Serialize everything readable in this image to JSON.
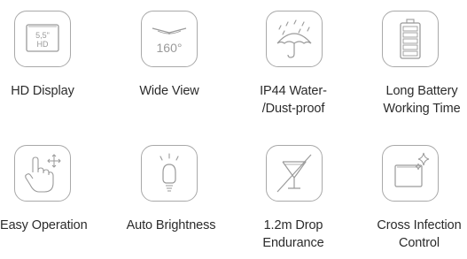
{
  "features": [
    {
      "icon": "hd-display-icon",
      "screen_size": "5,5\"",
      "screen_text": "HD",
      "lines": [
        "HD Display"
      ]
    },
    {
      "icon": "wide-view-icon",
      "angle_text": "160°",
      "lines": [
        "Wide View"
      ]
    },
    {
      "icon": "umbrella-rain-icon",
      "lines": [
        "IP44 Water-",
        "/Dust-proof"
      ]
    },
    {
      "icon": "battery-icon",
      "lines": [
        "Long Battery",
        "Working Time"
      ]
    },
    {
      "icon": "touch-hand-icon",
      "lines": [
        "Easy Operation"
      ]
    },
    {
      "icon": "light-bulb-icon",
      "lines": [
        "Auto Brightness"
      ]
    },
    {
      "icon": "broken-glass-icon",
      "lines": [
        "1.2m Drop",
        "Endurance"
      ]
    },
    {
      "icon": "sparkle-screen-icon",
      "lines": [
        "Cross Infection",
        "Control"
      ]
    }
  ],
  "colors": {
    "icon_stroke": "#9a9a9a",
    "text": "#2b2b2b"
  }
}
